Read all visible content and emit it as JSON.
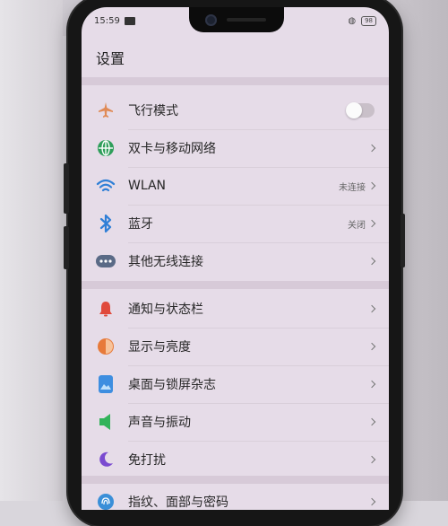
{
  "status_bar": {
    "time": "15:59",
    "battery": "98"
  },
  "page_title": "设置",
  "items": [
    {
      "label": "飞行模式",
      "icon": "airplane-icon",
      "color": "#e08a55",
      "kind": "toggle",
      "toggle_on": false
    },
    {
      "label": "双卡与移动网络",
      "icon": "globe-icon",
      "color": "#2e9e5a",
      "kind": "link"
    },
    {
      "label": "WLAN",
      "icon": "wifi-icon",
      "color": "#2f7fd6",
      "value": "未连接",
      "kind": "link"
    },
    {
      "label": "蓝牙",
      "icon": "bluetooth-icon",
      "color": "#2f7fd6",
      "value": "关闭",
      "kind": "link"
    },
    {
      "label": "其他无线连接",
      "icon": "more-dots-icon",
      "color": "#5a6a86",
      "kind": "link"
    },
    {
      "label": "通知与状态栏",
      "icon": "bell-icon",
      "color": "#e04a3c",
      "kind": "link"
    },
    {
      "label": "显示与亮度",
      "icon": "brightness-icon",
      "color": "#e77a3a",
      "kind": "link"
    },
    {
      "label": "桌面与锁屏杂志",
      "icon": "wallpaper-icon",
      "color": "#3e8ee0",
      "kind": "link"
    },
    {
      "label": "声音与振动",
      "icon": "speaker-icon",
      "color": "#32b35a",
      "kind": "link"
    },
    {
      "label": "免打扰",
      "icon": "moon-icon",
      "color": "#7a4ad0",
      "kind": "link"
    },
    {
      "label": "指纹、面部与密码",
      "icon": "fingerprint-icon",
      "color": "#3a8fd8",
      "kind": "link"
    }
  ]
}
